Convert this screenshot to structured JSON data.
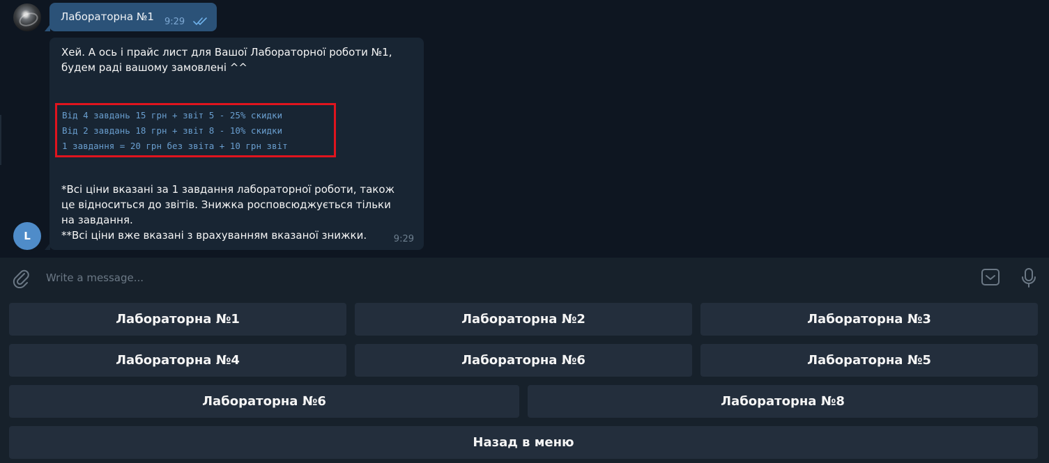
{
  "outgoing": {
    "text": "Лабораторна №1",
    "time": "9:29"
  },
  "incoming": {
    "intro": "Хей. А ось і прайс лист для Вашої Лабораторної роботи №1, будем раді вашому замовлені ^^",
    "code_lines": [
      "Від 4 завдань 15 грн + звіт 5 - 25% скидки",
      "Від 2 завдань 18 грн + звіт 8 - 10% скидки",
      "1 завдання = 20 грн без звіта + 10 грн звіт"
    ],
    "note_1": "*Всі ціни вказані за 1 завдання лабораторної роботи, також це відноситься до звітів. Знижка росповсюджується тільки на завдання.",
    "note_2": "**Всі ціни вже вказані з врахуванням вказаної знижки.",
    "time": "9:29",
    "sender_initial": "L"
  },
  "composer": {
    "placeholder": "Write a message..."
  },
  "keyboard": {
    "rows": [
      [
        "Лабораторна №1",
        "Лабораторна №2",
        "Лабораторна №3"
      ],
      [
        "Лабораторна №4",
        "Лабораторна №6",
        "Лабораторна №5"
      ],
      [
        "Лабораторна №6",
        "Лабораторна №8"
      ],
      [
        "Назад в меню"
      ]
    ]
  },
  "colors": {
    "background": "#0e1621",
    "outgoing_bubble": "#2b5278",
    "incoming_bubble": "#182533",
    "code_text": "#6a9fd0",
    "highlight_border": "#e0141e",
    "button": "#232e3c",
    "panel": "#17212b"
  }
}
